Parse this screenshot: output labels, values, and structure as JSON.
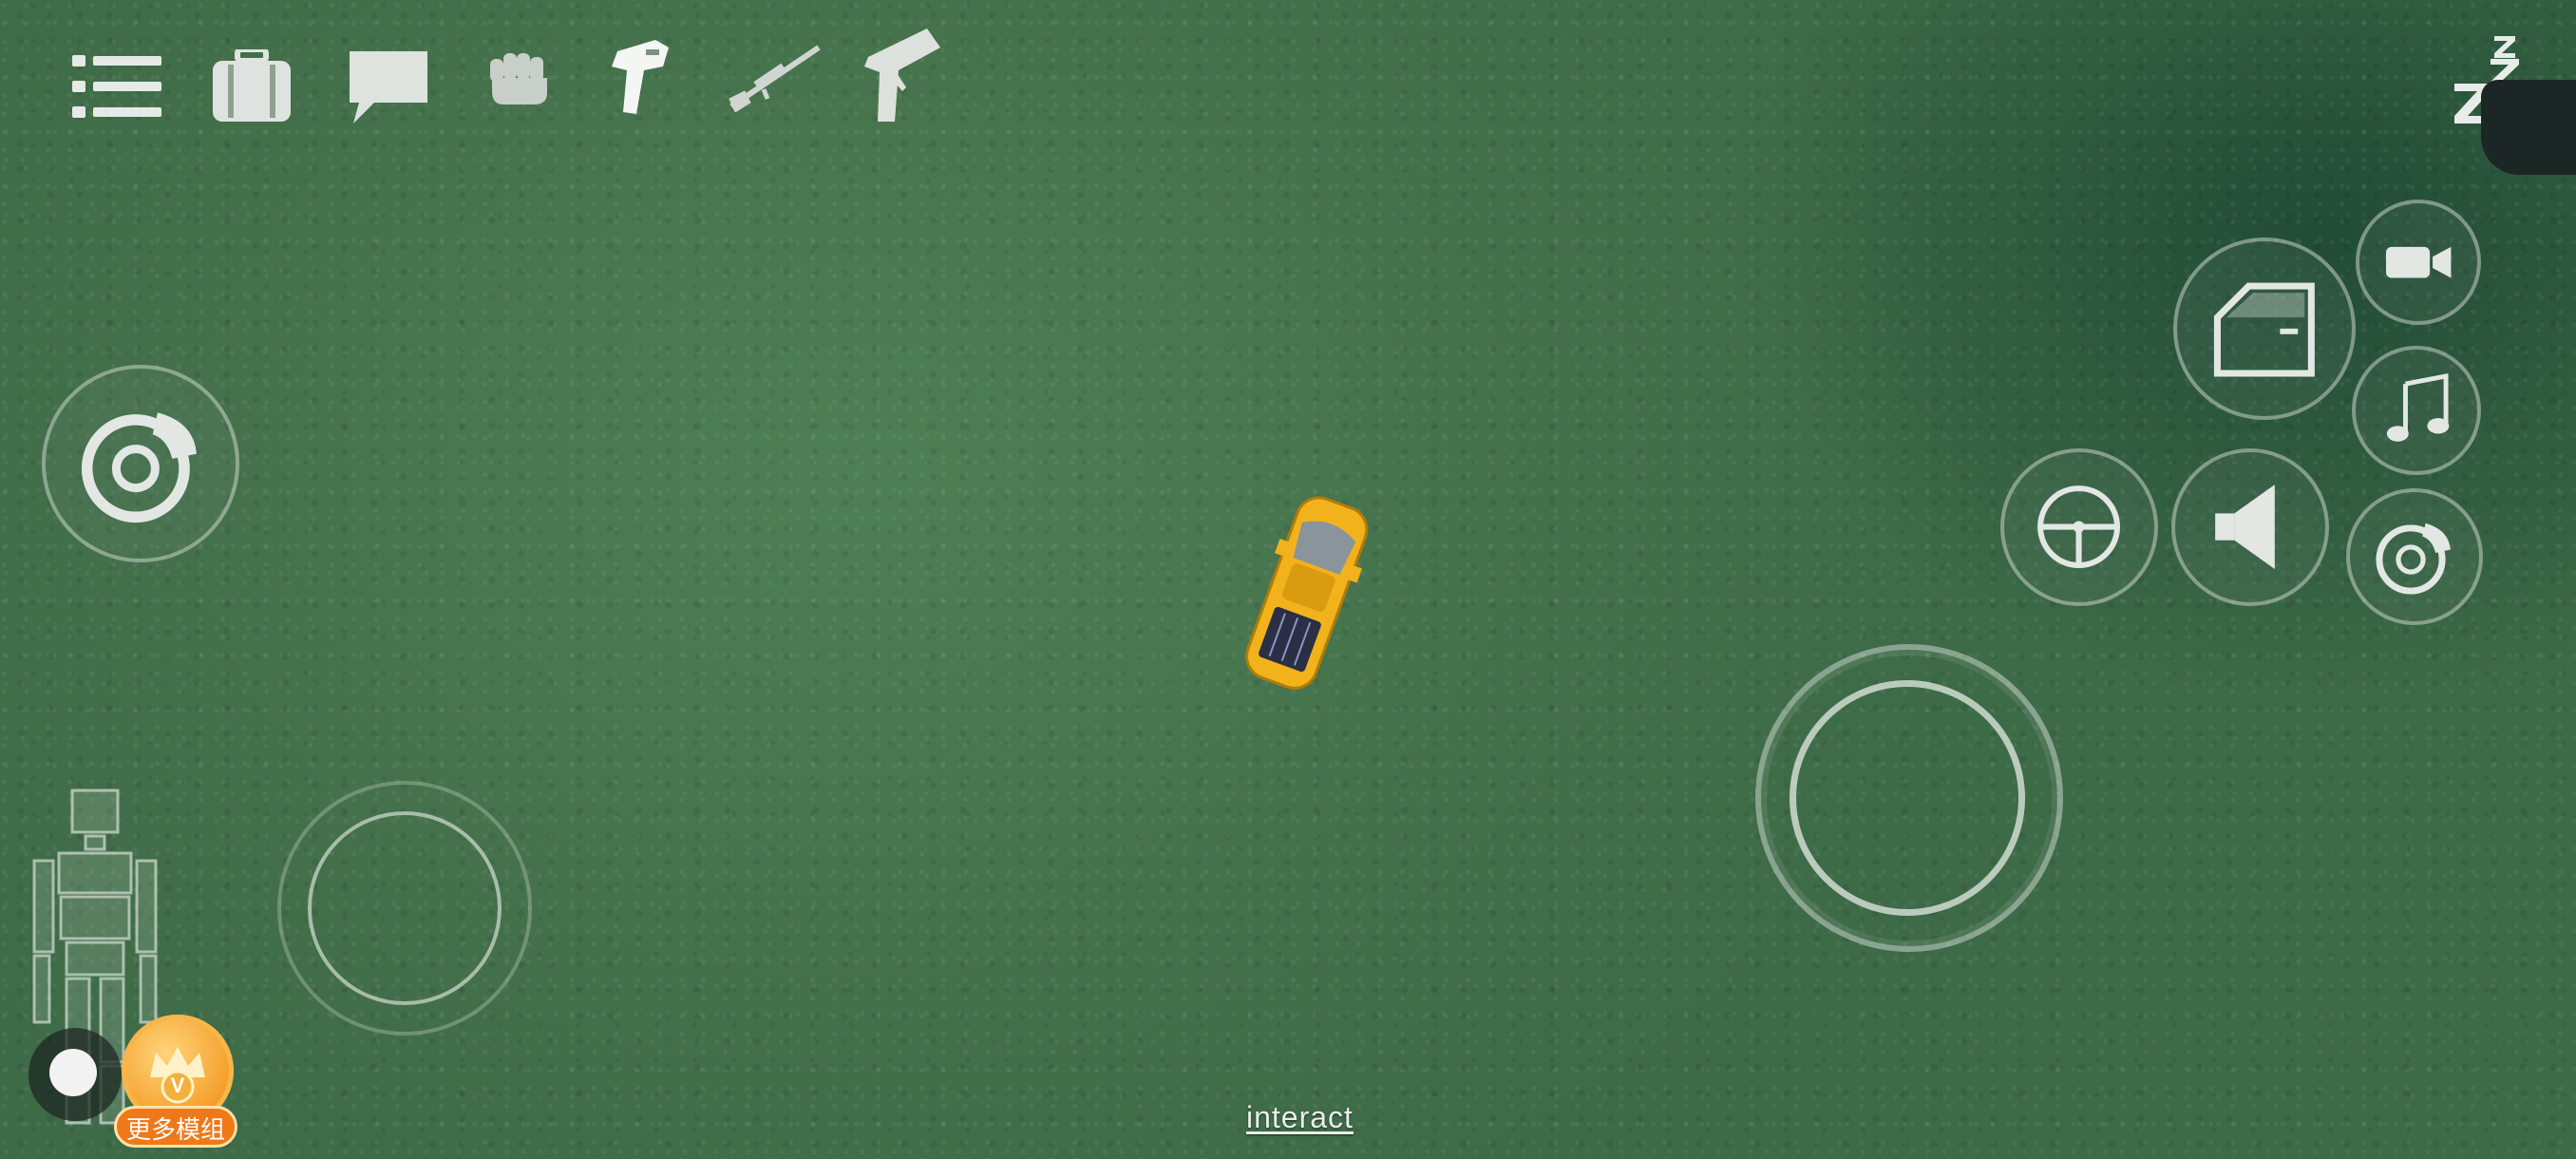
{
  "hud": {
    "interact_label": "interact",
    "mods_badge_label": "更多模组",
    "mods_badge_letter": "V"
  },
  "toolbar": {
    "items": [
      "menu-icon",
      "inventory-icon",
      "chat-icon",
      "fist-icon",
      "stun-gun-icon",
      "sniper-rifle-icon",
      "pistol-icon"
    ]
  },
  "colors": {
    "grass": "#44714b",
    "hud_icon": "#e8ece8",
    "car": "#f2b21c",
    "badge": "#f07818"
  }
}
